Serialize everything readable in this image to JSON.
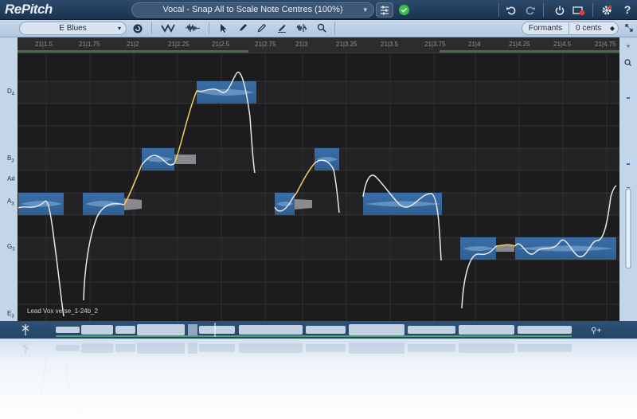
{
  "app": {
    "logo": "RePitch",
    "preset": "Vocal - Snap All to Scale Note Centres (100%)"
  },
  "toolbar": {
    "scale": "E Blues",
    "formants_label": "Formants",
    "cents_value": "0 cents"
  },
  "ruler": {
    "ticks": [
      "21|1.5",
      "21|1.75",
      "21|2",
      "21|2.25",
      "21|2.5",
      "21|2.75",
      "21|3",
      "21|3.25",
      "21|3.5",
      "21|3.75",
      "21|4",
      "21|4.25",
      "21|4.5",
      "21|4.75"
    ]
  },
  "notes": {
    "D4": {
      "letter": "D",
      "octave": "4"
    },
    "B3": {
      "letter": "B",
      "octave": "3"
    },
    "Asharp": {
      "letter": "A#",
      "octave": ""
    },
    "A3": {
      "letter": "A",
      "octave": "3"
    },
    "G3": {
      "letter": "G",
      "octave": "3"
    },
    "E3": {
      "letter": "E",
      "octave": "3"
    }
  },
  "track": {
    "name": "Lead Vox verse_1-24b_2"
  },
  "icons": {
    "undo": "undo-icon",
    "redo": "redo-icon",
    "power": "power-icon",
    "bypass": "bypass-icon",
    "settings": "gear-icon",
    "help": "help-icon",
    "zoom": "zoom-icon"
  },
  "colors": {
    "blob": "#3c6fa6",
    "pitch_curve": "#e8e8e8",
    "transition": "#f2d15b",
    "background": "#1c1c1e",
    "status_ok": "#3ac04a"
  }
}
